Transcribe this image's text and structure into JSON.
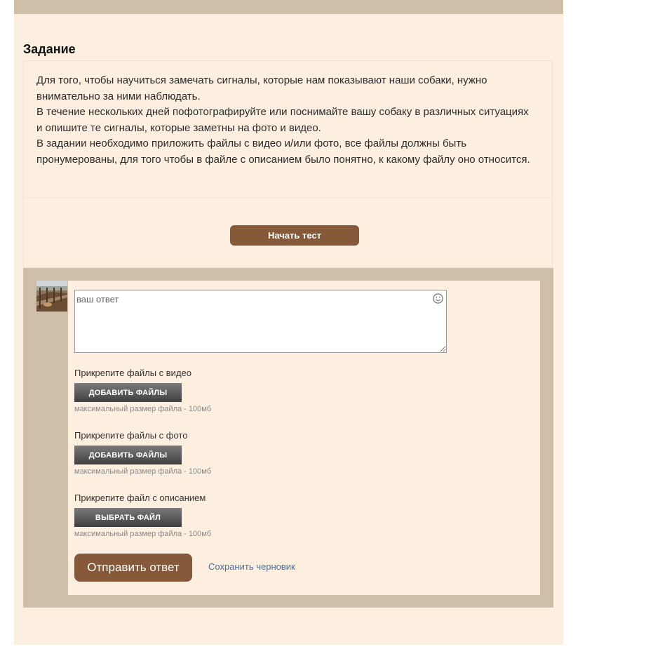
{
  "task": {
    "title": "Задание",
    "paragraphs": [
      "Для того, чтобы научиться замечать сигналы, которые нам показывают наши собаки, нужно внимательно за ними наблюдать.",
      "В течение нескольких дней пофотографируйте или поснимайте вашу собаку в различных ситуациях и опишите те сигналы, которые заметны на фото и видео.",
      "В задании необходимо приложить файлы с видео и/или фото, все файлы должны быть пронумерованы, для того чтобы в файле с описанием было понятно, к какому файлу оно относится."
    ],
    "start_button": "Начать тест"
  },
  "answer": {
    "placeholder": "ваш ответ",
    "emoji_icon": "smiley-icon",
    "uploads": [
      {
        "label": "Прикрепите файлы с видео",
        "button": "ДОБАВИТЬ ФАЙЛЫ",
        "hint": "максимальный размер файла - 100мб"
      },
      {
        "label": "Прикрепите файлы с фото",
        "button": "ДОБАВИТЬ ФАЙЛЫ",
        "hint": "максимальный размер файла - 100мб"
      },
      {
        "label": "Прикрепите файл с описанием",
        "button": "ВЫБРАТЬ ФАЙЛ",
        "hint": "максимальный размер файла - 100мб"
      }
    ],
    "submit_button": "Отправить ответ",
    "draft_link": "Сохранить черновик"
  },
  "colors": {
    "page_background": "#fcefe0",
    "header_bar": "#cfbea8",
    "accent_brown": "#85593a",
    "link_blue": "#4a6f9a"
  }
}
